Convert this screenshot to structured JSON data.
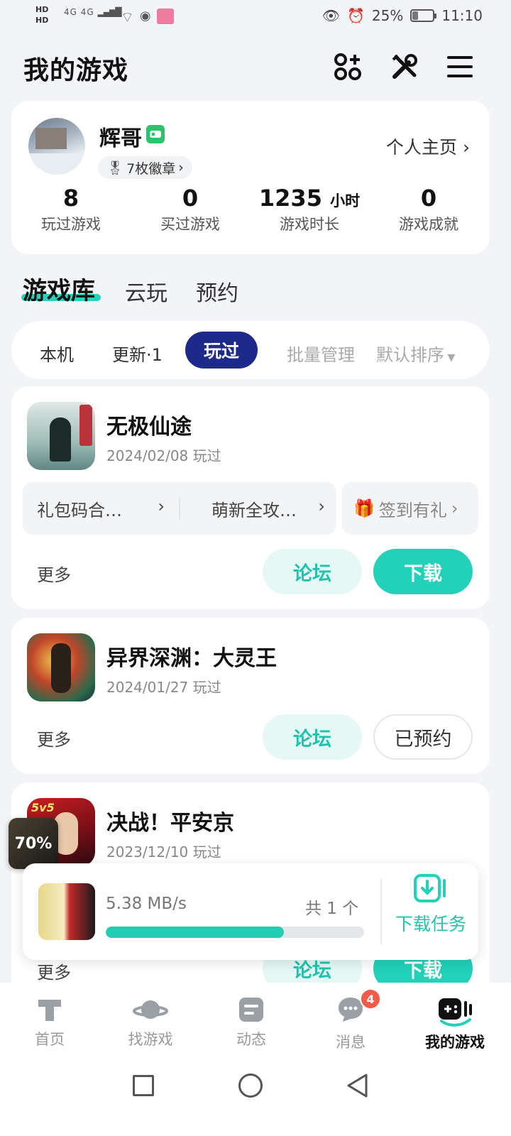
{
  "status_bar": {
    "left_hd1": "HD",
    "left_hd2": "HD",
    "signal": "4G 4G",
    "battery": "25%",
    "battery_level": 0.25,
    "time": "11:10"
  },
  "header": {
    "title": "我的游戏",
    "icons": [
      "apps-add-icon",
      "tools-icon",
      "menu-icon"
    ]
  },
  "profile": {
    "username": "辉哥",
    "badges_label": "7枚徽章",
    "home_link": "个人主页",
    "stats": [
      {
        "value": "8",
        "unit": "",
        "label": "玩过游戏"
      },
      {
        "value": "0",
        "unit": "",
        "label": "买过游戏"
      },
      {
        "value": "1235",
        "unit": "小时",
        "label": "游戏时长"
      },
      {
        "value": "0",
        "unit": "",
        "label": "游戏成就"
      }
    ]
  },
  "library_tabs": [
    "游戏库",
    "云玩",
    "预约"
  ],
  "filters": {
    "items": [
      "本机",
      "更新·1"
    ],
    "active": "玩过",
    "batch": "批量管理",
    "sort": "默认排序"
  },
  "games": [
    {
      "title": "无极仙途",
      "date": "2024/02/08 玩过",
      "links": [
        "礼包码合…",
        "萌新全攻…"
      ],
      "signin": "签到有礼",
      "more": "更多",
      "forum": "论坛",
      "action": "下载"
    },
    {
      "title": "异界深渊：大灵王",
      "date": "2024/01/27 玩过",
      "more": "更多",
      "forum": "论坛",
      "action": "已预约"
    },
    {
      "title": "决战！平安京",
      "date": "2023/12/10 玩过",
      "more": "更多",
      "forum": "论坛",
      "action": "下载",
      "icon_text": "5v5"
    }
  ],
  "download_panel": {
    "speed": "5.38 MB/s",
    "count": "共 1 个",
    "progress": 0.69,
    "task_label": "下载任务"
  },
  "mini_float": {
    "percent": "70%"
  },
  "bottom_nav": [
    {
      "label": "首页",
      "icon": "home-t-icon"
    },
    {
      "label": "找游戏",
      "icon": "planet-icon"
    },
    {
      "label": "动态",
      "icon": "feed-icon"
    },
    {
      "label": "消息",
      "icon": "message-icon",
      "badge": "4"
    },
    {
      "label": "我的游戏",
      "icon": "gamepad-icon",
      "active": true
    }
  ],
  "colors": {
    "accent": "#23d1b8",
    "active_pill": "#1e2a8a",
    "badge_red": "#f25a4a",
    "vip_green": "#2cc46b"
  }
}
